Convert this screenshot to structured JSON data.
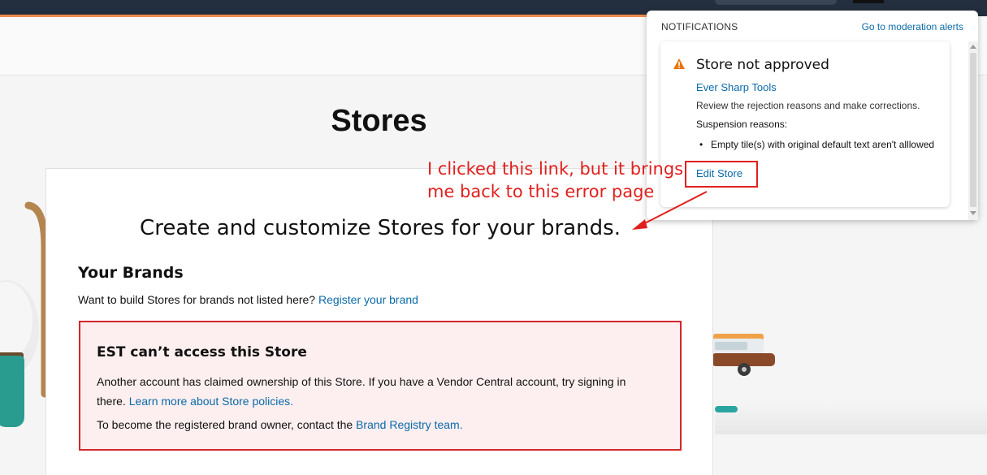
{
  "page": {
    "title": "Stores"
  },
  "main": {
    "heading": "Create and customize Stores for your brands.",
    "brands_title": "Your Brands",
    "brands_prompt": "Want to build Stores for brands not listed here?",
    "register_link": "Register your brand"
  },
  "error": {
    "title": "EST can’t access this Store",
    "line1": "Another account has claimed ownership of this Store. If you have a Vendor Central account, try signing in there.",
    "policies_link": "Learn more about Store policies.",
    "line2": "To become the registered brand owner, contact the",
    "registry_link": "Brand Registry team."
  },
  "notifications": {
    "header": "NOTIFICATIONS",
    "moderation_link": "Go to moderation alerts",
    "item": {
      "title": "Store not approved",
      "brand": "Ever Sharp Tools",
      "description": "Review the rejection reasons and make corrections.",
      "reasons_label": "Suspension reasons:",
      "reason": "Empty tile(s) with original default text aren't alllowed",
      "edit_link": "Edit Store",
      "icon": "warning-triangle-icon",
      "icon_color": "#e8760c"
    }
  },
  "annotation": {
    "line1": "I clicked this link, but it brings",
    "line2": "me back to this error page",
    "color": "#e0201e"
  },
  "colors": {
    "link": "#0a6aa8",
    "error_border": "#d5262b",
    "error_bg": "#fdeff0",
    "topbar": "#232f3e",
    "accent": "#f08a4b"
  }
}
